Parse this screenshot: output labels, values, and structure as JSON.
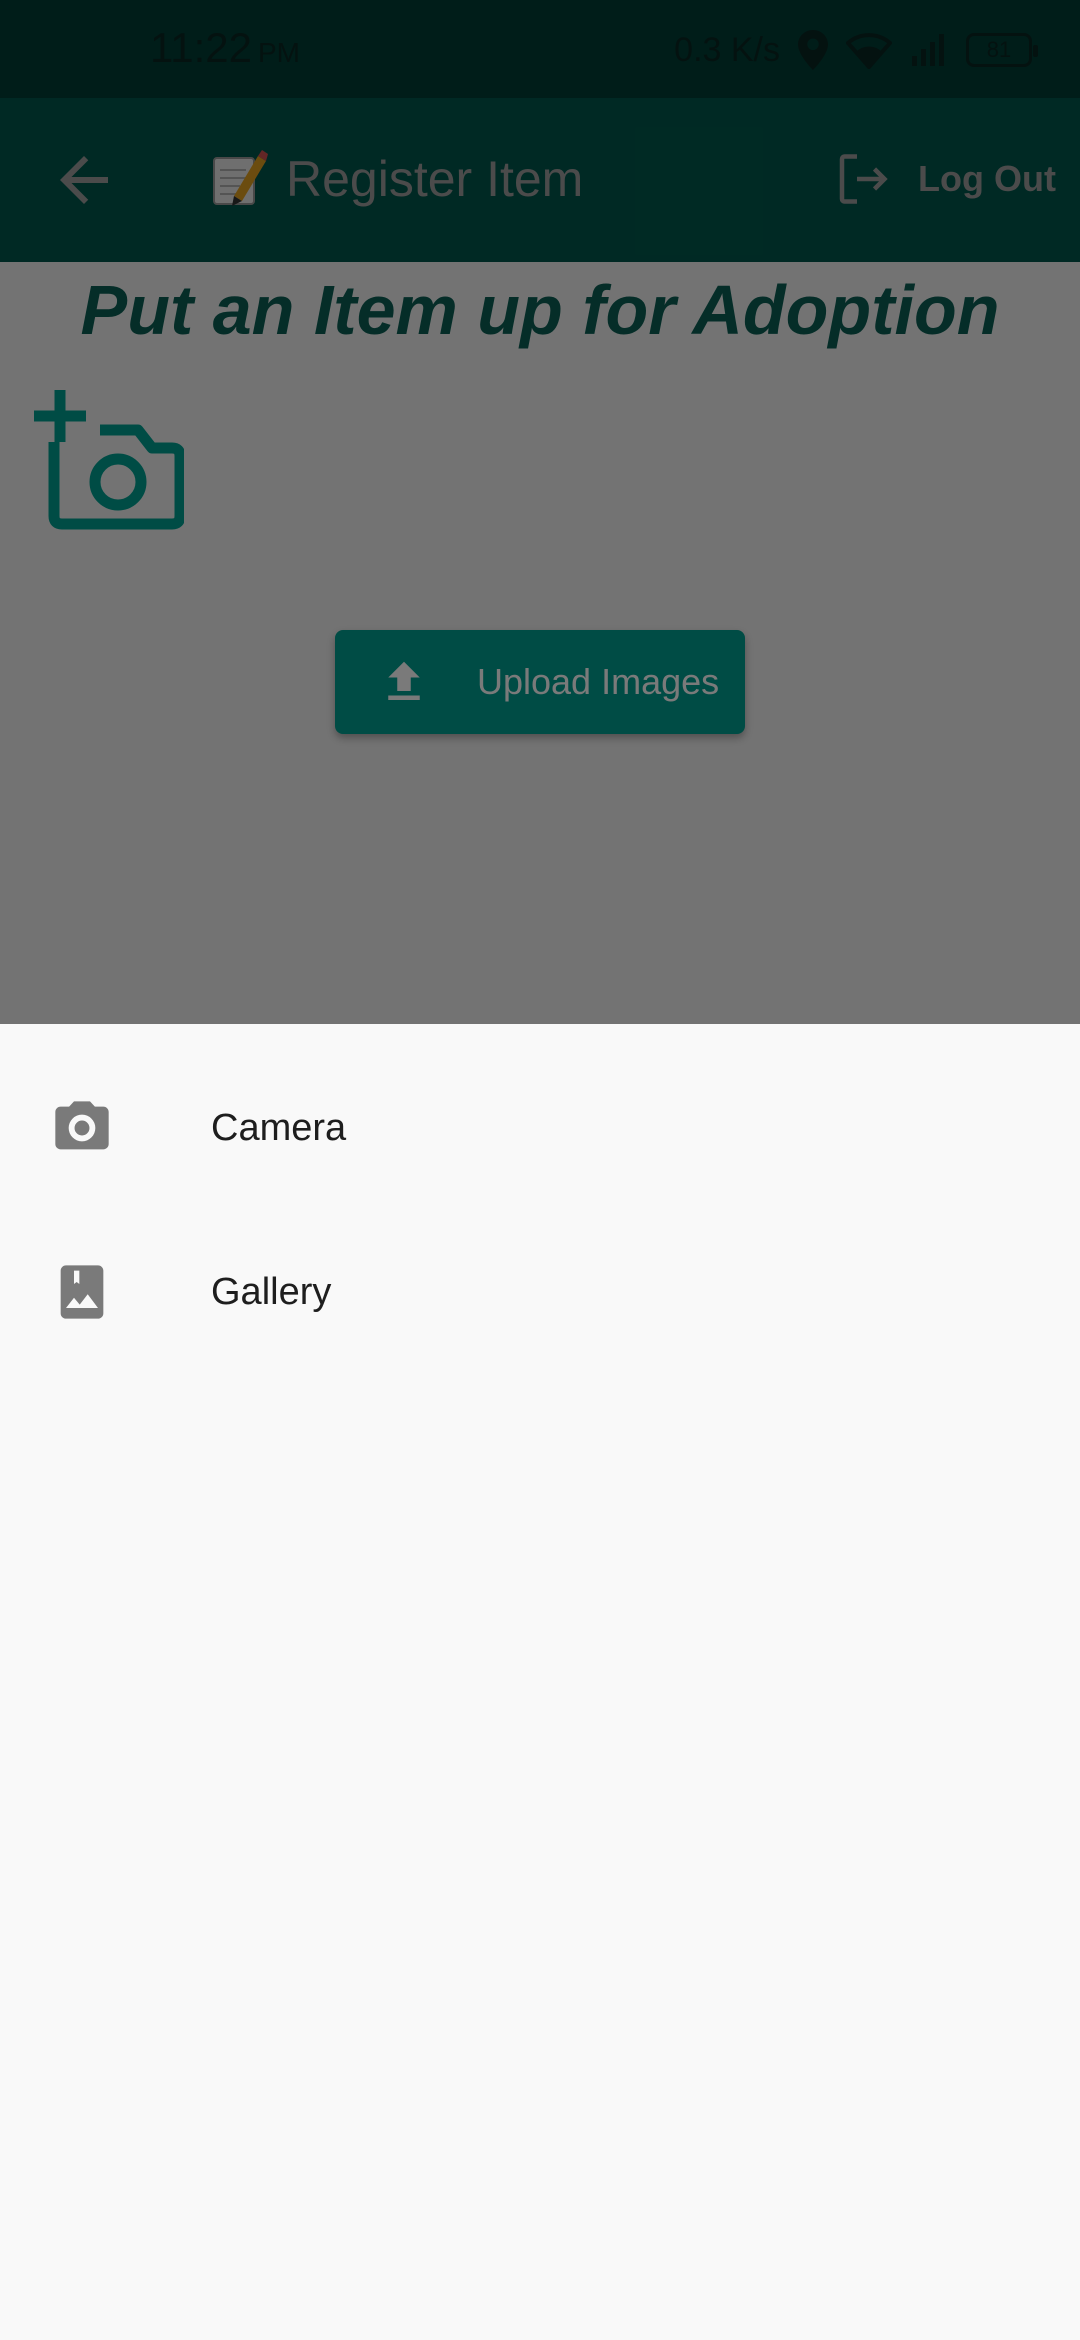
{
  "status_bar": {
    "time": "11:22",
    "ampm": "PM",
    "net_speed": "0.3 K/s",
    "battery": "81"
  },
  "app_bar": {
    "title": "Register Item",
    "logout_label": "Log Out"
  },
  "content": {
    "headline": "Put an Item up for Adoption",
    "upload_label": "Upload Images"
  },
  "sheet": {
    "items": [
      {
        "label": "Camera",
        "icon": "camera-icon"
      },
      {
        "label": "Gallery",
        "icon": "gallery-icon"
      }
    ]
  },
  "colors": {
    "primary": "#00574c",
    "accent": "#00a090",
    "sheet_bg": "#f9f9f9",
    "sheet_icon": "#7a7a7a"
  }
}
